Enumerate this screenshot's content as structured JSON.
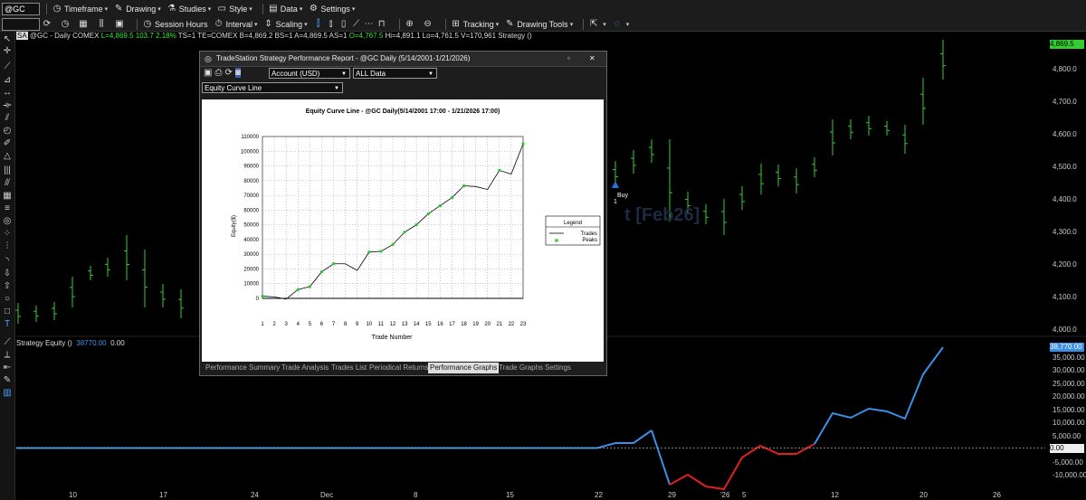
{
  "toolbar": {
    "symbol": "@GC",
    "timeframe": "Timeframe",
    "drawing": "Drawing",
    "studies": "Studies",
    "style": "Style",
    "data": "Data",
    "settings": "Settings",
    "session_hours": "Session Hours",
    "interval": "Interval",
    "scaling": "Scaling",
    "tracking": "Tracking",
    "drawing_tools": "Drawing Tools"
  },
  "chart": {
    "tag": "SA",
    "symbol_desc": "@GC - Daily  COMEX",
    "last": "L=4,869.5",
    "change": "103.7",
    "pct": "2.18%",
    "info_rest": "TS=1  TE=COMEX  B=4,869.2  BS=1  A=4,869.5  AS=1",
    "open": "O=4,767.5",
    "info_tail": "Hi=4,891.1  Lo=4,761.5  V=170,961  Strategy ()",
    "watermark": "Buy",
    "buy_label": "Buy",
    "buy_qty": "1",
    "current_price": "4,869.5",
    "price_labels": [
      "4,800.0",
      "4,700.0",
      "4,600.0",
      "4,500.0",
      "4,400.0",
      "4,300.0",
      "4,200.0",
      "4,100.0",
      "4,000.0"
    ],
    "bg_text": "t [Feb26]",
    "colors": {
      "bar": "#33cc33",
      "equity": "#3b8fe6",
      "drawdown": "#e02020",
      "axis_highlight": "#3b8fe6"
    }
  },
  "subgraph": {
    "title": "Strategy Equity ()",
    "value1": "38770.00",
    "value2": "0.00",
    "current_value": "38,770.00",
    "zero_label": "0.00",
    "axis_labels": [
      "35,000.00",
      "30,000.00",
      "25,000.00",
      "20,000.00",
      "15,000.00",
      "10,000.00",
      "5,000.00",
      "-5,000.00",
      "-10,000.00"
    ]
  },
  "dates": [
    "10",
    "17",
    "24",
    "Dec",
    "8",
    "15",
    "22",
    "29",
    "'26",
    "5",
    "12",
    "20",
    "26"
  ],
  "dialog": {
    "title": "TradeStation Strategy Performance Report - @GC Daily (5/14/2001-1/21/2026)",
    "account_select": "Account (USD)",
    "period_select": "ALL Data",
    "graph_select": "Equity Curve Line",
    "tabs": [
      "Performance Summary",
      "Trade Analysis",
      "Trades List",
      "Periodical Returns",
      "Performance Graphs",
      "Trade Graphs",
      "Settings"
    ],
    "active_tab": "Performance Graphs"
  },
  "chart_data": {
    "type": "line",
    "title": "Equity Curve Line - @GC Daily(5/14/2001 17:00 - 1/21/2026 17:00)",
    "xlabel": "Trade Number",
    "ylabel": "Equity($)",
    "x": [
      1,
      2,
      3,
      4,
      5,
      6,
      7,
      8,
      9,
      10,
      11,
      12,
      13,
      14,
      15,
      16,
      17,
      18,
      19,
      20,
      21,
      22,
      23
    ],
    "ylim": [
      0,
      110000
    ],
    "yticks": [
      0,
      10000,
      20000,
      30000,
      40000,
      50000,
      60000,
      70000,
      80000,
      90000,
      100000,
      110000
    ],
    "series": [
      {
        "name": "Trades",
        "values": [
          1500,
          1000,
          -500,
          6000,
          8000,
          18000,
          23500,
          23500,
          19000,
          31500,
          32000,
          36500,
          45000,
          50000,
          57500,
          63000,
          68500,
          76500,
          76000,
          74000,
          87000,
          84500,
          105000
        ]
      },
      {
        "name": "Peaks",
        "x": [
          1,
          4,
          5,
          6,
          7,
          10,
          11,
          12,
          13,
          14,
          15,
          16,
          17,
          18,
          21,
          23
        ],
        "values": [
          1500,
          6000,
          8000,
          18000,
          23500,
          31500,
          32000,
          36500,
          45000,
          50000,
          57500,
          63000,
          68500,
          76500,
          87000,
          105000
        ]
      }
    ],
    "legend": {
      "title": "Legend",
      "position": "right"
    }
  }
}
